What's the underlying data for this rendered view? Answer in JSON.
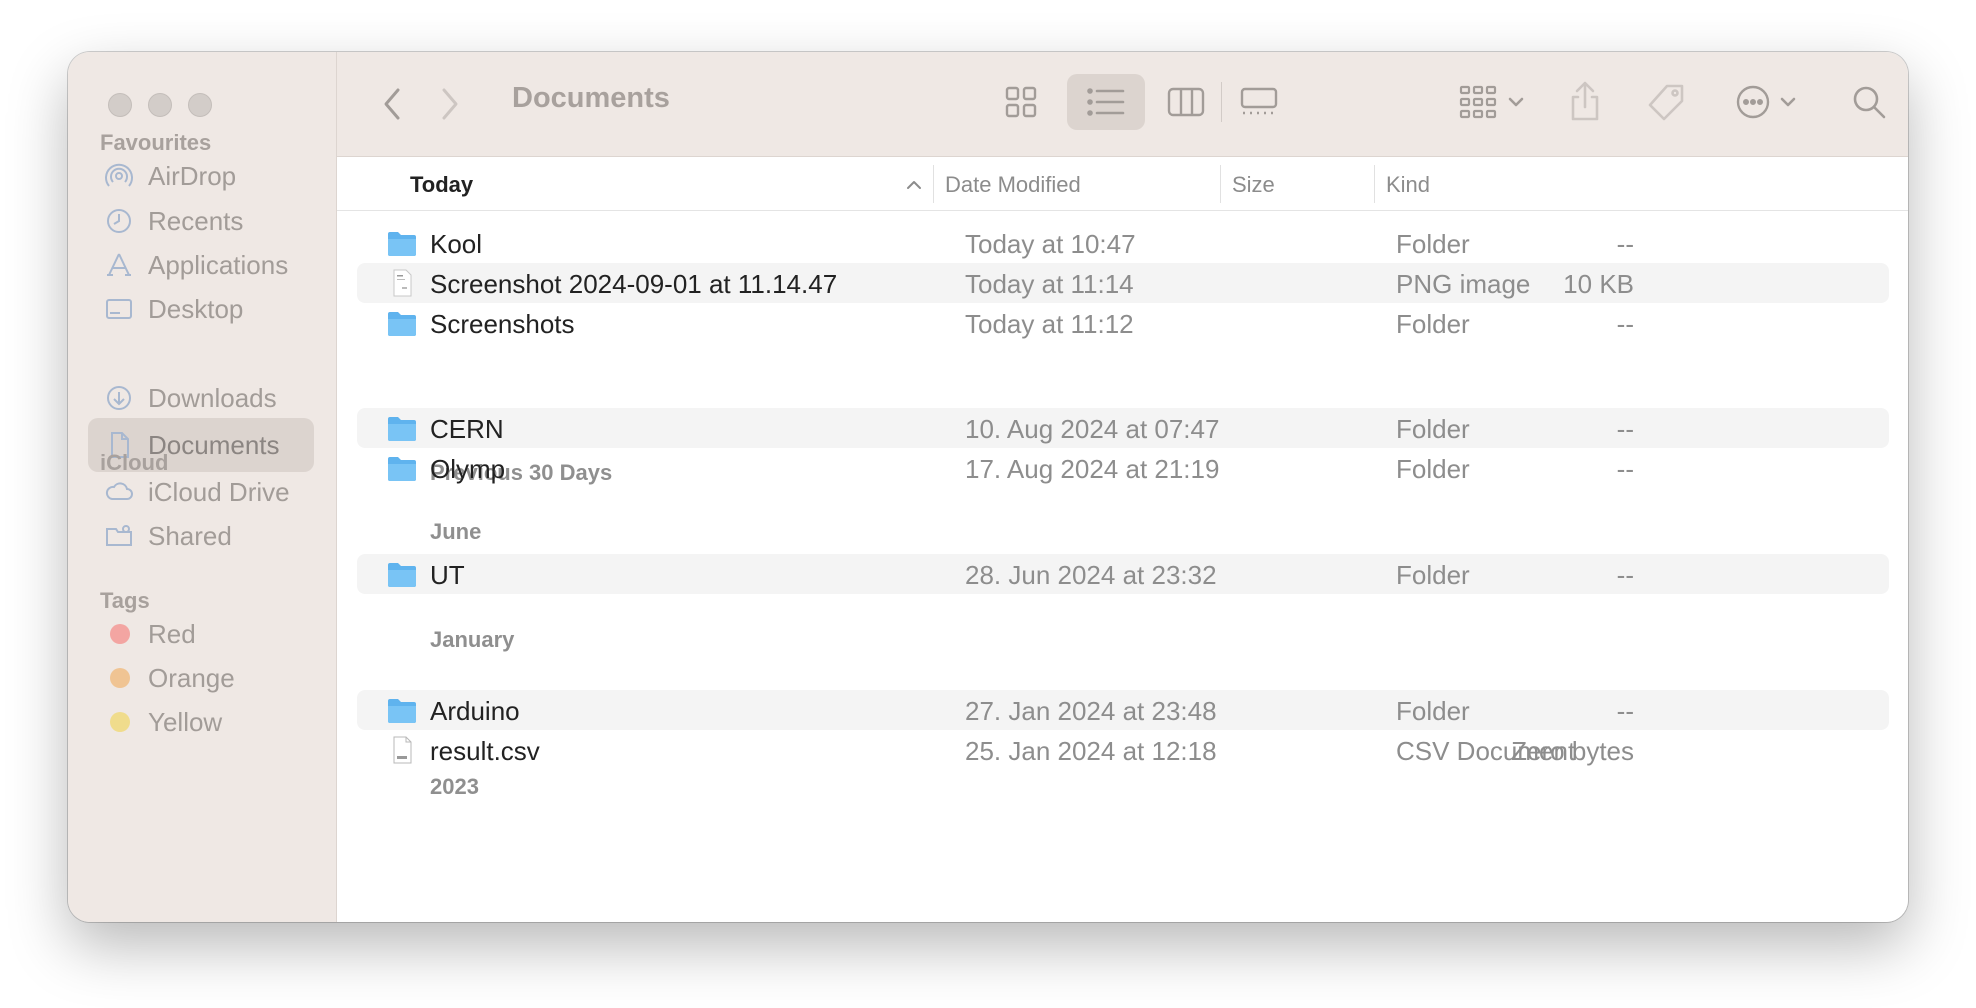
{
  "window": {
    "title": "Documents"
  },
  "sidebar": {
    "sections": [
      {
        "label": "Favourites"
      },
      {
        "label": "iCloud"
      },
      {
        "label": "Tags"
      }
    ],
    "favourites": [
      {
        "label": "AirDrop",
        "icon": "airdrop-icon"
      },
      {
        "label": "Recents",
        "icon": "clock-icon"
      },
      {
        "label": "Applications",
        "icon": "applications-icon"
      },
      {
        "label": "Desktop",
        "icon": "desktop-icon"
      },
      {
        "label": "Documents",
        "icon": "document-icon",
        "selected": true
      },
      {
        "label": "Downloads",
        "icon": "download-icon"
      }
    ],
    "icloud": [
      {
        "label": "iCloud Drive",
        "icon": "cloud-icon"
      },
      {
        "label": "Shared",
        "icon": "shared-folder-icon"
      }
    ],
    "tags": [
      {
        "label": "Red",
        "color": "#f3a5a2"
      },
      {
        "label": "Orange",
        "color": "#f0c493"
      },
      {
        "label": "Yellow",
        "color": "#f0dc8c"
      }
    ]
  },
  "columns": {
    "name": "Today",
    "date": "Date Modified",
    "size": "Size",
    "kind": "Kind"
  },
  "groups": [
    {
      "label": "Today",
      "rows": [
        {
          "name": "Kool",
          "date": "Today at 10:47",
          "size": "--",
          "kind": "Folder",
          "icon": "folder-icon"
        },
        {
          "name": "Screenshot 2024-09-01 at 11.14.47",
          "date": "Today at 11:14",
          "size": "10 KB",
          "kind": "PNG image",
          "icon": "image-file-icon"
        },
        {
          "name": "Screenshots",
          "date": "Today at 11:12",
          "size": "--",
          "kind": "Folder",
          "icon": "folder-icon"
        }
      ]
    },
    {
      "label": "Previous 30 Days",
      "rows": [
        {
          "name": "CERN",
          "date": "10. Aug 2024 at 07:47",
          "size": "--",
          "kind": "Folder",
          "icon": "folder-icon"
        },
        {
          "name": "Olymp",
          "date": "17. Aug 2024 at 21:19",
          "size": "--",
          "kind": "Folder",
          "icon": "folder-icon"
        }
      ]
    },
    {
      "label": "June",
      "rows": [
        {
          "name": "UT",
          "date": "28. Jun 2024 at 23:32",
          "size": "--",
          "kind": "Folder",
          "icon": "folder-icon"
        }
      ]
    },
    {
      "label": "January",
      "rows": [
        {
          "name": "Arduino",
          "date": "27. Jan 2024 at 23:48",
          "size": "--",
          "kind": "Folder",
          "icon": "folder-icon"
        },
        {
          "name": "result.csv",
          "date": "25. Jan 2024 at 12:18",
          "size": "Zero bytes",
          "kind": "CSV Document",
          "icon": "csv-file-icon"
        }
      ]
    },
    {
      "label": "2023",
      "rows": []
    }
  ],
  "colors": {
    "sidebar_bg": "#efe8e4",
    "selection_bg": "#dcd4cf",
    "folder_blue": "#5fb3ee",
    "alt_row": "#f4f4f4"
  }
}
